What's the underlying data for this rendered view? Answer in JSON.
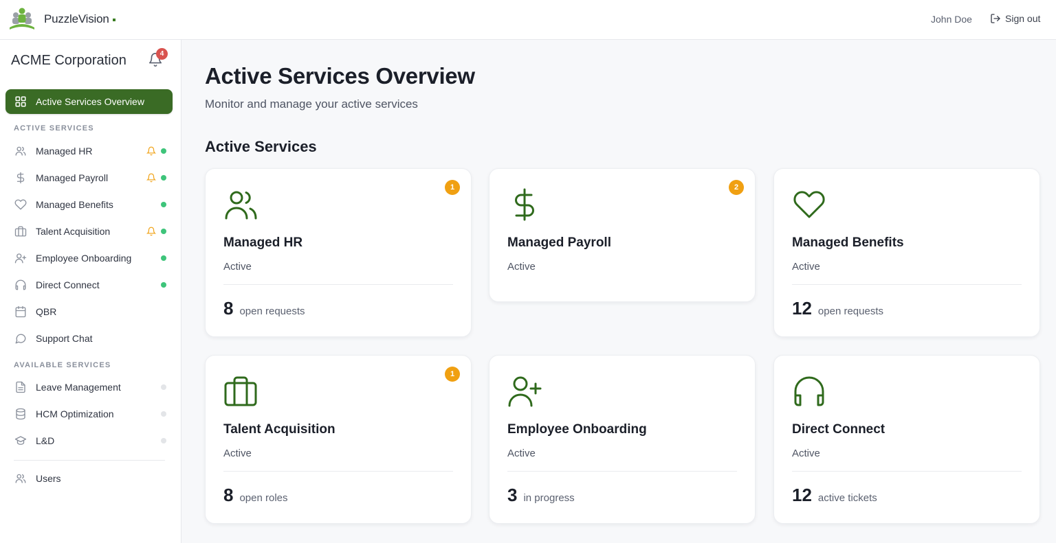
{
  "header": {
    "brand": "PuzzleVision",
    "user_name": "John Doe",
    "sign_out_label": "Sign out"
  },
  "sidebar": {
    "org_name": "ACME Corporation",
    "notification_count": "4",
    "active_item_label": "Active Services Overview",
    "active_services_heading": "ACTIVE SERVICES",
    "available_services_heading": "AVAILABLE SERVICES",
    "active_services": [
      {
        "label": "Managed HR",
        "icon": "users-icon",
        "alert": true,
        "status": "green"
      },
      {
        "label": "Managed Payroll",
        "icon": "dollar-icon",
        "alert": true,
        "status": "green"
      },
      {
        "label": "Managed Benefits",
        "icon": "heart-icon",
        "alert": false,
        "status": "green"
      },
      {
        "label": "Talent Acquisition",
        "icon": "briefcase-icon",
        "alert": true,
        "status": "green"
      },
      {
        "label": "Employee Onboarding",
        "icon": "user-plus-icon",
        "alert": false,
        "status": "green"
      },
      {
        "label": "Direct Connect",
        "icon": "headphones-icon",
        "alert": false,
        "status": "green"
      },
      {
        "label": "QBR",
        "icon": "calendar-icon",
        "alert": false,
        "status": "none"
      },
      {
        "label": "Support Chat",
        "icon": "chat-bubble-icon",
        "alert": false,
        "status": "none"
      }
    ],
    "available_services": [
      {
        "label": "Leave Management",
        "icon": "document-icon",
        "status": "grey"
      },
      {
        "label": "HCM Optimization",
        "icon": "database-icon",
        "status": "grey"
      },
      {
        "label": "L&D",
        "icon": "graduation-cap-icon",
        "status": "grey"
      }
    ],
    "users_label": "Users"
  },
  "main": {
    "title": "Active Services Overview",
    "subtitle": "Monitor and manage your active services",
    "section_title": "Active Services",
    "cards": [
      {
        "name": "Managed HR",
        "status": "Active",
        "badge": "1",
        "number": "8",
        "unit": "open requests",
        "icon": "users-icon"
      },
      {
        "name": "Managed Payroll",
        "status": "Active",
        "badge": "2",
        "number": "",
        "unit": "",
        "icon": "dollar-icon"
      },
      {
        "name": "Managed Benefits",
        "status": "Active",
        "badge": "",
        "number": "12",
        "unit": "open requests",
        "icon": "heart-icon"
      },
      {
        "name": "Talent Acquisition",
        "status": "Active",
        "badge": "1",
        "number": "8",
        "unit": "open roles",
        "icon": "briefcase-icon"
      },
      {
        "name": "Employee Onboarding",
        "status": "Active",
        "badge": "",
        "number": "3",
        "unit": "in progress",
        "icon": "user-plus-icon"
      },
      {
        "name": "Direct Connect",
        "status": "Active",
        "badge": "",
        "number": "12",
        "unit": "active tickets",
        "icon": "headphones-icon"
      }
    ]
  },
  "colors": {
    "brand_green": "#3a6b25",
    "icon_green": "#2f6a1c",
    "status_green": "#3ec47a",
    "badge_orange": "#f0a012",
    "notification_red": "#d9534f",
    "alert_bell": "#f0a012"
  }
}
